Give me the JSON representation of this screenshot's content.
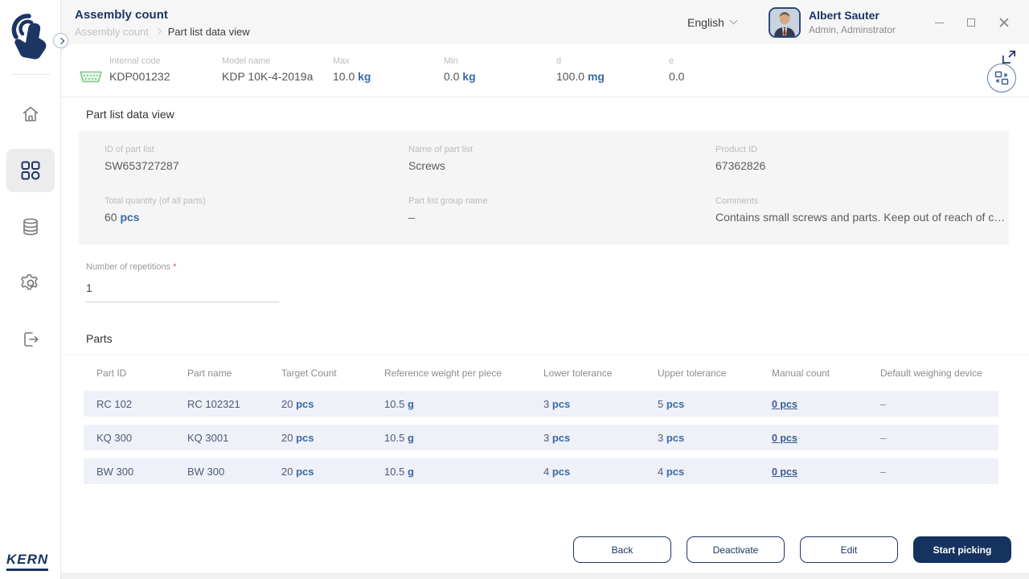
{
  "app": {
    "title": "Assembly count",
    "breadcrumb": {
      "parent": "Assembly count",
      "current": "Part list data view"
    }
  },
  "topbar": {
    "language": "English",
    "user": {
      "name": "Albert Sauter",
      "role": "Admin, Adminstrator"
    },
    "icons": [
      "chevron-down-icon",
      "avatar",
      "minimize-icon",
      "maximize-icon",
      "close-icon"
    ]
  },
  "sidebar": {
    "icons": [
      "touch-logo-icon",
      "home-icon",
      "apps-grid-icon",
      "database-icon",
      "gear-icon",
      "logout-icon"
    ],
    "selected_item": "apps-grid",
    "brand": "KERN"
  },
  "device_bar": {
    "connection_icon": "connector-icon",
    "fields": [
      {
        "label": "Internal code",
        "value": "KDP001232",
        "unit": ""
      },
      {
        "label": "Model name",
        "value": "KDP 10K-4-2019a",
        "unit": ""
      },
      {
        "label": "Max",
        "value": "10.0",
        "unit": "kg"
      },
      {
        "label": "Min",
        "value": "0.0",
        "unit": "kg"
      },
      {
        "label": "d",
        "value": "100.0",
        "unit": "mg"
      },
      {
        "label": "e",
        "value": "0.0",
        "unit": ""
      }
    ],
    "icons": [
      "expand-icon",
      "switch-device-icon"
    ]
  },
  "page": {
    "heading": "Part list data view"
  },
  "details": {
    "id_of_part_list": {
      "label": "ID of part list",
      "value": "SW653727287"
    },
    "name_of_part_list": {
      "label": "Name of part list",
      "value": "Screws"
    },
    "product_id": {
      "label": "Product ID",
      "value": "67362826"
    },
    "total_quantity": {
      "label": "Total quantity (of all parts)",
      "value": "60",
      "unit": "pcs"
    },
    "group_name": {
      "label": "Part list group name",
      "value": "–"
    },
    "comments": {
      "label": "Comments",
      "value": "Contains small screws and parts. Keep out of reach of c…"
    }
  },
  "repetitions": {
    "label": "Number of repetitions ",
    "required_mark": "*",
    "value": "1"
  },
  "parts": {
    "heading": "Parts",
    "columns": [
      "Part ID",
      "Part name",
      "Target Count",
      "Reference weight per piece",
      "Lower tolerance",
      "Upper tolerance",
      "Manual count",
      "Default weighing device"
    ],
    "rows": [
      {
        "part_id": "RC 102",
        "part_name": "RC 102321",
        "target": "20",
        "target_unit": "pcs",
        "ref_weight": "10.5",
        "ref_unit": "g",
        "lower": "3",
        "lower_unit": "pcs",
        "upper": "5",
        "upper_unit": "pcs",
        "manual": "0 pcs",
        "device": "–"
      },
      {
        "part_id": "KQ 300",
        "part_name": "KQ 3001",
        "target": "20",
        "target_unit": "pcs",
        "ref_weight": "10.5",
        "ref_unit": "g",
        "lower": "3",
        "lower_unit": "pcs",
        "upper": "3",
        "upper_unit": "pcs",
        "manual": "0 pcs",
        "device": "–"
      },
      {
        "part_id": "BW 300",
        "part_name": "BW 300",
        "target": "20",
        "target_unit": "pcs",
        "ref_weight": "10.5",
        "ref_unit": "g",
        "lower": "4",
        "lower_unit": "pcs",
        "upper": "4",
        "upper_unit": "pcs",
        "manual": "0 pcs",
        "device": "–"
      }
    ]
  },
  "footer": {
    "back": "Back",
    "deactivate": "Deactivate",
    "edit": "Edit",
    "start_picking": "Start picking"
  },
  "colors": {
    "primary": "#16335f",
    "unit_blue": "#3a6ba5",
    "row_bg": "#eef1f8",
    "connected_green": "#7cc98a"
  }
}
